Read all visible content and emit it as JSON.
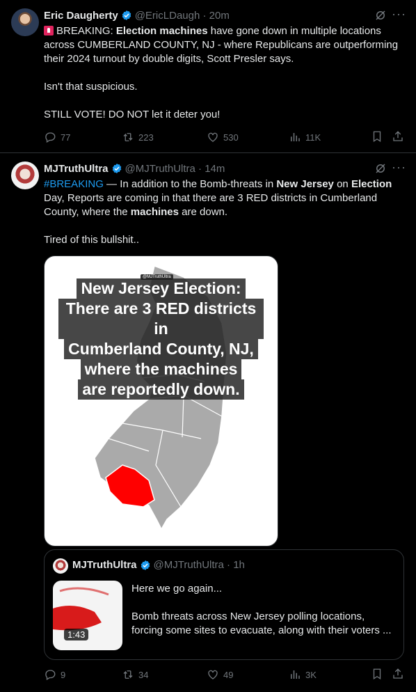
{
  "tweets": [
    {
      "author": {
        "name": "Eric Daugherty",
        "handle": "@EricLDaugh",
        "time": "20m"
      },
      "segments": {
        "s1": "BREAKING: ",
        "s2": "Election machines",
        "s3": " have gone down in multiple locations across CUMBERLAND COUNTY, NJ - where Republicans are outperforming their 2024 turnout by double digits, Scott Presler says.",
        "p2": "Isn't that suspicious.",
        "p3": "STILL VOTE! DO NOT let it deter you!"
      },
      "stats": {
        "replies": "77",
        "reposts": "223",
        "likes": "530",
        "views": "11K"
      }
    },
    {
      "author": {
        "name": "MJTruthUltra",
        "handle": "@MJTruthUltra",
        "time": "14m"
      },
      "segments": {
        "hashtag": "#BREAKING",
        "s1": " — In addition to the Bomb-threats in ",
        "s2": "New Jersey",
        "s3": " on ",
        "s4": "Election",
        "s5": " Day, Reports are coming in that there are 3 RED districts in Cumberland County, where the ",
        "s6": "machines",
        "s7": " are down.",
        "p2": "Tired of this bullshit.."
      },
      "media": {
        "caption_lines": [
          "New Jersey Election:",
          "There are 3 RED districts in",
          "Cumberland County, NJ,",
          "where the machines",
          "are reportedly down."
        ],
        "watermark": "@MJTruthUltra",
        "map_color": "#aaaaaa",
        "highlight_color": "#ff0000"
      },
      "quote": {
        "author": {
          "name": "MJTruthUltra",
          "handle": "@MJTruthUltra",
          "time": "1h"
        },
        "p1": "Here we go again...",
        "p2": "Bomb threats across New Jersey polling locations, forcing some sites to evacuate, along with their voters ...",
        "duration": "1:43"
      },
      "stats": {
        "replies": "9",
        "reposts": "34",
        "likes": "49",
        "views": "3K"
      }
    }
  ],
  "colors": {
    "accent": "#1d9bf0",
    "text": "#e7e9ea",
    "muted": "#71767b",
    "border": "#2f3336"
  },
  "icons": [
    "verified-badge-icon",
    "grok-icon",
    "more-icon",
    "reply-icon",
    "repost-icon",
    "like-icon",
    "views-icon",
    "bookmark-icon",
    "share-icon",
    "siren-emoji"
  ]
}
